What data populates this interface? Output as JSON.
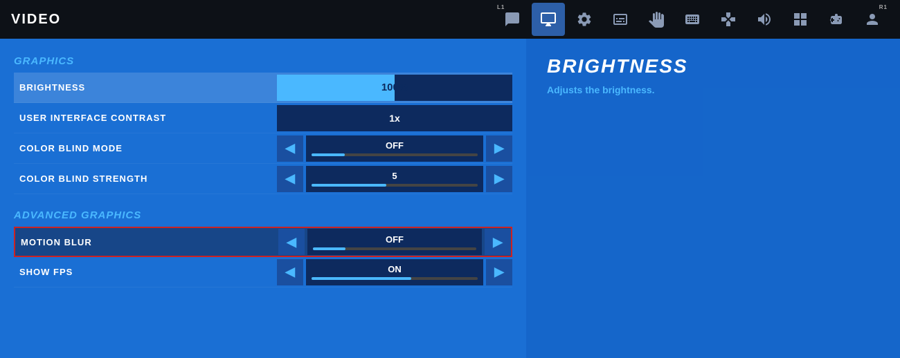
{
  "header": {
    "title": "VIDEO",
    "corner_left": "L1",
    "corner_right": "R1"
  },
  "nav": {
    "icons": [
      {
        "name": "chat-icon",
        "symbol": "💬",
        "active": false
      },
      {
        "name": "display-icon",
        "symbol": "🖥",
        "active": true
      },
      {
        "name": "gear-icon",
        "symbol": "⚙",
        "active": false
      },
      {
        "name": "controller-icon-ea",
        "symbol": "📺",
        "active": false
      },
      {
        "name": "hand-icon",
        "symbol": "🖐",
        "active": false
      },
      {
        "name": "keyboard-icon",
        "symbol": "⌨",
        "active": false
      },
      {
        "name": "gamepad-icon",
        "symbol": "🎮",
        "active": false
      },
      {
        "name": "speaker-icon",
        "symbol": "🔊",
        "active": false
      },
      {
        "name": "grid-icon",
        "symbol": "▦",
        "active": false
      },
      {
        "name": "controller2-icon",
        "symbol": "🕹",
        "active": false
      },
      {
        "name": "person-icon",
        "symbol": "👤",
        "active": false
      }
    ]
  },
  "sections": [
    {
      "id": "graphics",
      "title": "GRAPHICS",
      "rows": [
        {
          "id": "brightness",
          "label": "BRIGHTNESS",
          "type": "slider_bar",
          "value": "100",
          "unit": "%",
          "fill_pct": 50,
          "highlighted": true
        },
        {
          "id": "ui_contrast",
          "label": "USER INTERFACE CONTRAST",
          "type": "value",
          "value": "1x"
        },
        {
          "id": "color_blind_mode",
          "label": "COLOR BLIND MODE",
          "type": "arrow_slider",
          "value": "OFF",
          "slider_fill_pct": 20
        },
        {
          "id": "color_blind_strength",
          "label": "COLOR BLIND STRENGTH",
          "type": "arrow_slider",
          "value": "5",
          "slider_fill_pct": 45
        }
      ]
    },
    {
      "id": "advanced_graphics",
      "title": "ADVANCED GRAPHICS",
      "rows": [
        {
          "id": "motion_blur",
          "label": "MOTION BLUR",
          "type": "arrow_slider",
          "value": "OFF",
          "slider_fill_pct": 20,
          "active_selection": true
        },
        {
          "id": "show_fps",
          "label": "SHOW FPS",
          "type": "arrow_slider",
          "value": "ON",
          "slider_fill_pct": 60
        }
      ]
    }
  ],
  "detail": {
    "title": "BRIGHTNESS",
    "description": "Adjusts the brightness."
  }
}
